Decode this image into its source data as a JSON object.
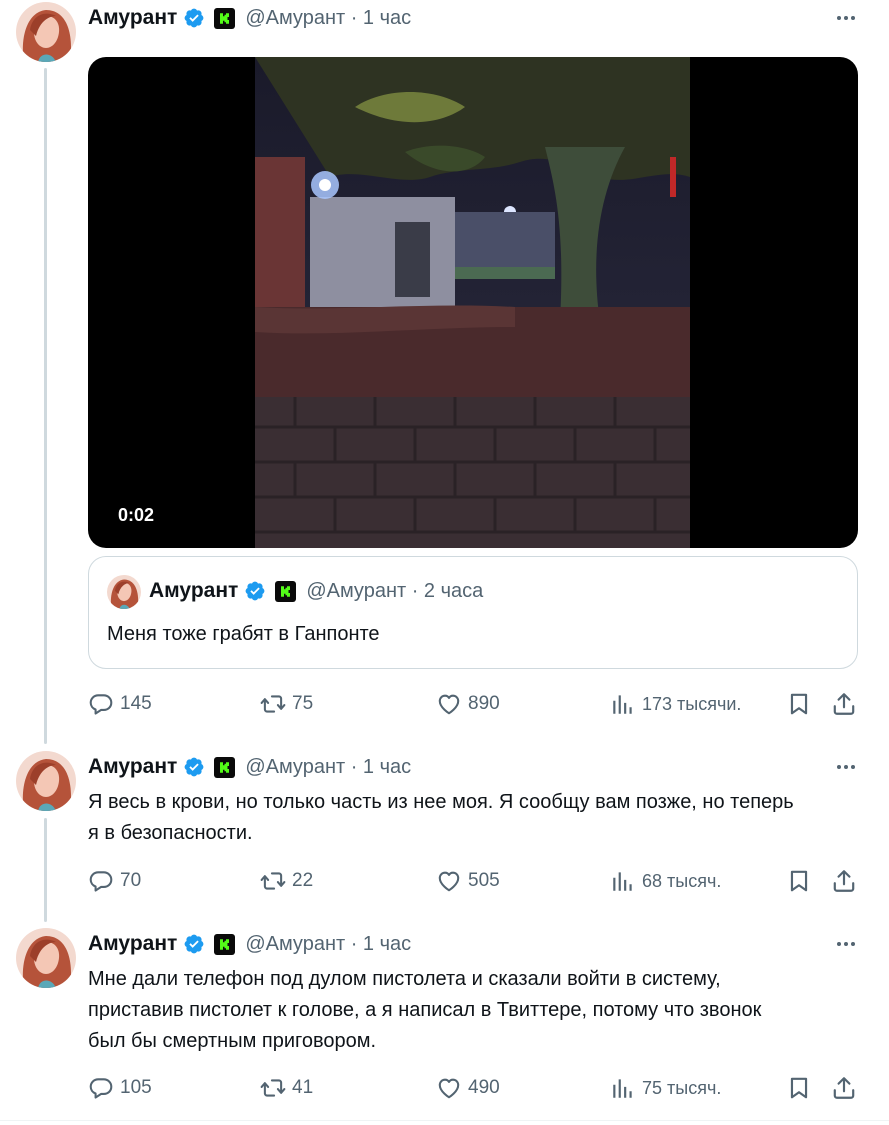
{
  "tweets": [
    {
      "author": "Амурант",
      "handle": "@Амурант · 1 час",
      "has_video": true,
      "video_time": "0:02",
      "quote": {
        "author": "Амурант",
        "handle": "@Амурант · 2 часа",
        "text": "Меня тоже грабят в Ганпонте"
      },
      "replies": "145",
      "reposts": "75",
      "likes": "890",
      "views": "173 тысячи."
    },
    {
      "author": "Амурант",
      "handle": "@Амурант · 1 час",
      "text_lines": [
        "Я весь в крови, но только часть из нее моя. Я сообщу вам позже, но теперь",
        "я в безопасности."
      ],
      "replies": "70",
      "reposts": "22",
      "likes": "505",
      "views": "68 тысяч."
    },
    {
      "author": "Амурант",
      "handle": "@Амурант · 1 час",
      "text_lines": [
        "Мне дали телефон под дулом пистолета и сказали войти в систему,",
        "приставив пистолет к голове, а я написал в Твиттере, потому что звонок",
        "был бы смертным приговором."
      ],
      "replies": "105",
      "reposts": "41",
      "likes": "490",
      "views": "75 тысяч."
    }
  ],
  "icons": {
    "verified": "verified-badge-icon",
    "community": "k-badge-icon",
    "more": "more-icon",
    "reply": "reply-icon",
    "repost": "repost-icon",
    "like": "heart-icon",
    "views": "views-icon",
    "bookmark": "bookmark-icon",
    "share": "share-icon"
  },
  "colors": {
    "verified": "#1d9bf0",
    "kbadge_green": "#53fc18",
    "muted": "#536471",
    "border": "#cfd9de"
  }
}
